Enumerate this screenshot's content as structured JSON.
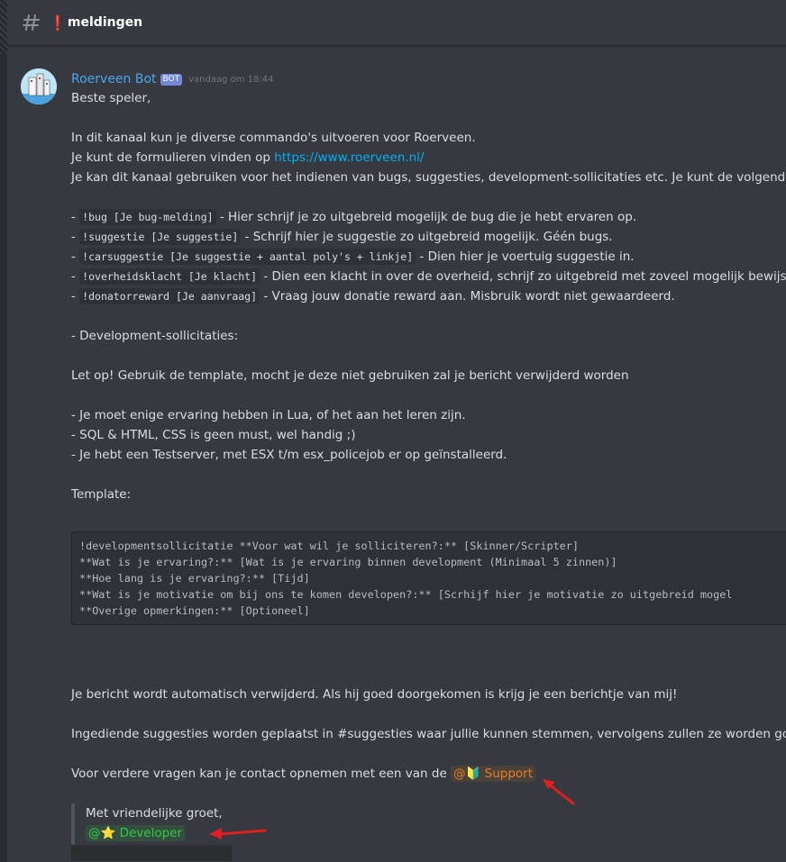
{
  "channel": {
    "prefix": "❗",
    "name": "meldingen"
  },
  "message": {
    "author": "Roerveen Bot",
    "bot_tag": "BOT",
    "timestamp": "vandaag om 18:44",
    "greeting": "Beste speler,",
    "intro1": "In dit kanaal kun je diverse commando's uitvoeren voor Roerveen.",
    "intro2_text": "Je kunt de formulieren vinden op ",
    "intro2_link": "https://www.roerveen.nl/",
    "intro3": "Je kan dit kanaal gebruiken voor het indienen van bugs, suggesties, development-sollicitaties etc. Je kunt de volgende co",
    "commands": [
      {
        "code": "!bug [Je bug-melding]",
        "text": " - Hier schrijf je zo uitgebreid mogelijk de bug die je hebt ervaren op."
      },
      {
        "code": "!suggestie [Je suggestie]",
        "text": " - Schrijf hier je suggestie zo uitgebreid mogelijk. Géén bugs."
      },
      {
        "code": "!carsuggestie [Je suggestie + aantal poly's + linkje]",
        "text": " - Dien hier je voertuig suggestie in."
      },
      {
        "code": "!overheidsklacht [Je klacht]",
        "text": " - Dien een klacht in over de overheid, schrijf zo uitgebreid met zoveel mogelijk bewijs j"
      },
      {
        "code": "!donatorreward [Je aanvraag]",
        "text": " - Vraag jouw donatie reward aan. Misbruik wordt niet gewaardeerd."
      }
    ],
    "dash": "- ",
    "dev_heading": "- Development-sollicitaties:",
    "warning": "Let op! Gebruik de template, mocht je deze niet gebruiken zal je bericht verwijderd worden",
    "requirements": [
      "- Je moet enige ervaring hebben in Lua, of het aan het leren zijn.",
      "- SQL & HTML, CSS is geen must, wel handig ;)",
      "- Je hebt een Testserver, met ESX t/m esx_policejob er op geïnstalleerd."
    ],
    "template_label": "Template:",
    "template_lines": [
      "!developmentsollicitatie **Voor wat wil je solliciteren?:** [Skinner/Scripter]",
      "**Wat is je ervaring?:** [Wat is je ervaring binnen development (Minimaal 5 zinnen)]",
      "**Hoe lang is je ervaring?:** [Tijd]",
      "**Wat is je motivatie om bij ons te komen developen?:** [Scrhijf hier je motivatie zo uitgebreid mogel",
      "**Overige opmerkingen:** [Optioneel]"
    ],
    "auto_delete": "Je bericht wordt automatisch verwijderd. Als hij goed doorgekomen is krijg je een berichtje van mij!",
    "suggestions_note": "Ingediende suggesties worden geplaatst in #suggesties waar jullie kunnen stemmen, vervolgens zullen ze worden goed/",
    "contact_text": "Voor verdere vragen kan je contact opnemen met een van de ",
    "mention_support": {
      "at": "@",
      "emoji": "🔰",
      "label": " Support"
    },
    "signoff": "Met vriendelijke groet,",
    "mention_dev": {
      "at": "@",
      "emoji": "⭐",
      "label": " Developer"
    }
  },
  "colors": {
    "background": "#36393f",
    "username": "#48a6ef",
    "link": "#00b0f4",
    "support_mention": "#e67e22",
    "developer_mention": "#2ecc40",
    "annotation_arrow": "#e02020"
  },
  "icons": [
    "text-channel-hash-icon",
    "bot-avatar",
    "red-arrow-annotation"
  ]
}
